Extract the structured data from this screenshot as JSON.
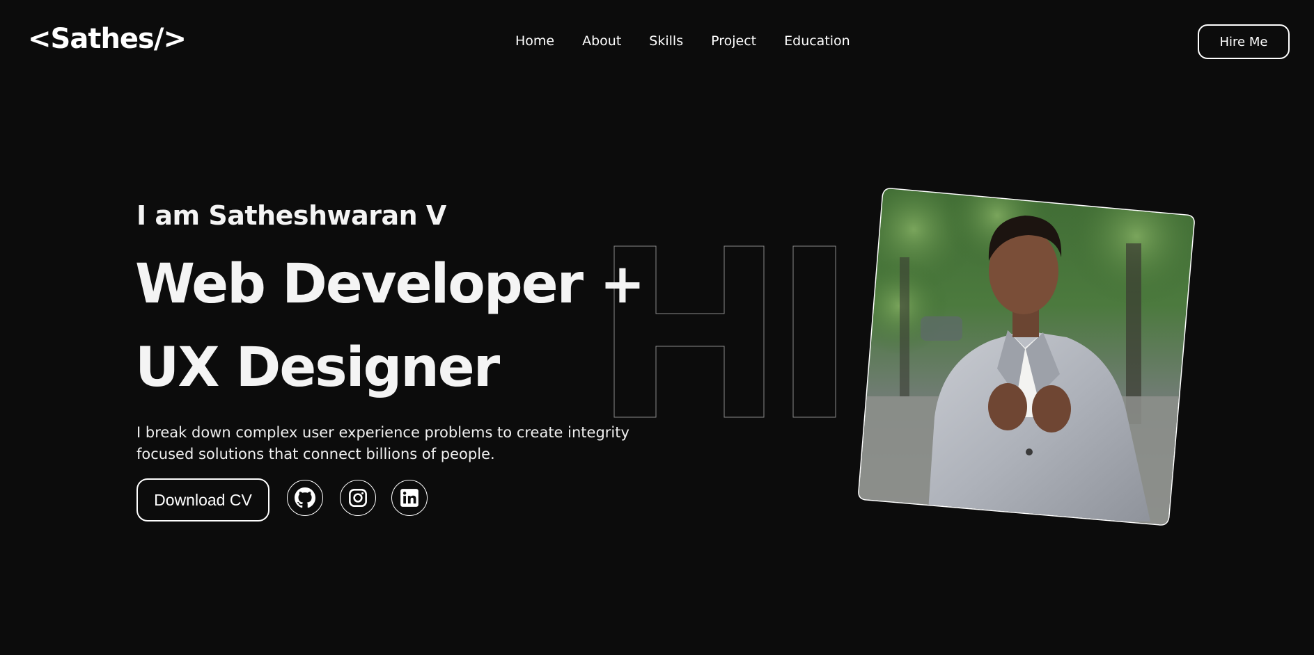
{
  "header": {
    "logo": "<Sathes/>",
    "nav": [
      "Home",
      "About",
      "Skills",
      "Project",
      "Education"
    ],
    "hire_label": "Hire Me"
  },
  "hero": {
    "intro": "I am Satheshwaran V",
    "headline_line1": "Web Developer +",
    "headline_line2": "UX Designer",
    "background_word": "HI",
    "description_line1": "I break down complex user experience problems to create integrity",
    "description_line2": "focused solutions that connect billions of people.",
    "cv_label": "Download CV",
    "social_icons": [
      "github-icon",
      "instagram-icon",
      "linkedin-icon"
    ]
  },
  "colors": {
    "background": "#0c0c0c",
    "text": "#f4f4f4",
    "outline": "#ffffff"
  }
}
